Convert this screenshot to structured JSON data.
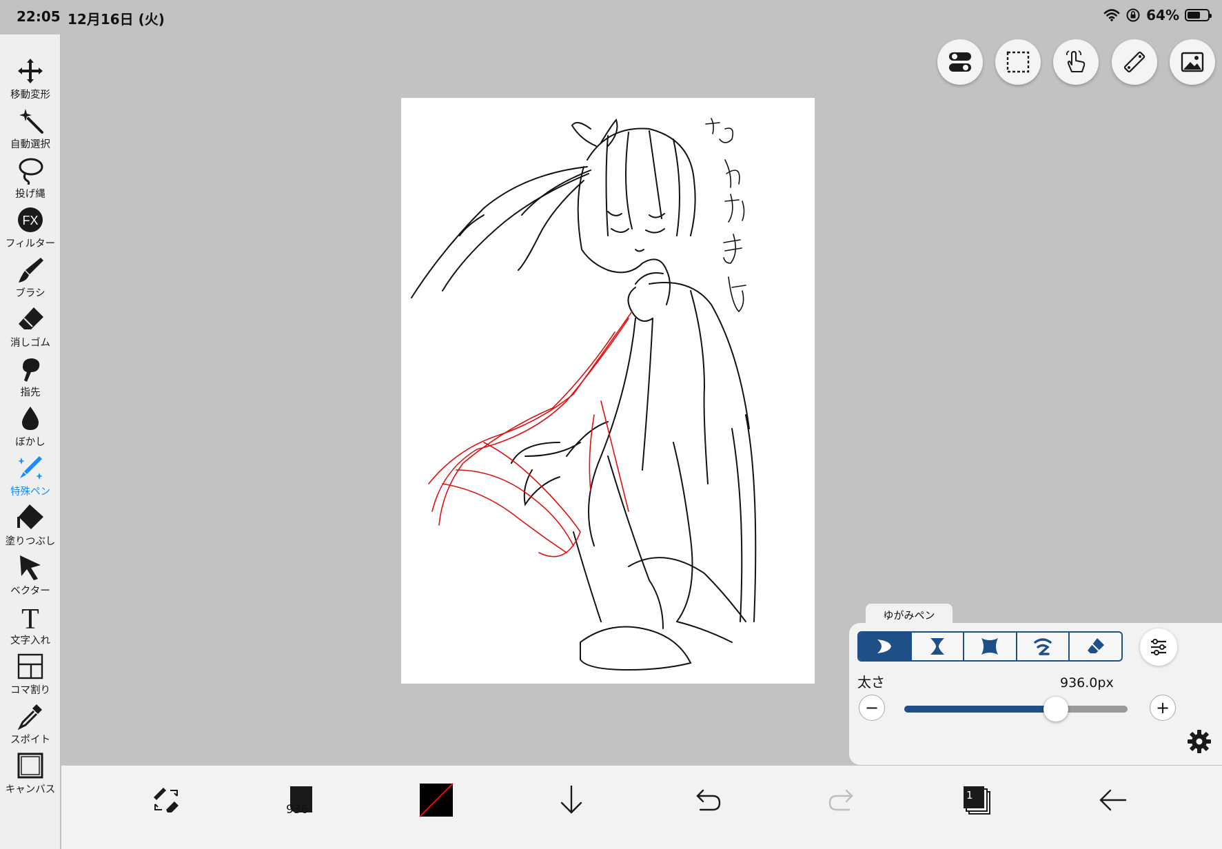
{
  "status": {
    "time": "22:05",
    "date": "12月16日 (火)",
    "battery": "64%",
    "battery_level": 0.64
  },
  "tools": [
    {
      "label": "移動変形",
      "icon": "move-arrows-icon"
    },
    {
      "label": "自動選択",
      "icon": "magic-wand-icon"
    },
    {
      "label": "投げ縄",
      "icon": "lasso-icon"
    },
    {
      "label": "フィルター",
      "icon": "fx-filter-icon"
    },
    {
      "label": "ブラシ",
      "icon": "brush-icon"
    },
    {
      "label": "消しゴム",
      "icon": "eraser-icon"
    },
    {
      "label": "指先",
      "icon": "finger-smudge-icon"
    },
    {
      "label": "ぼかし",
      "icon": "blur-drop-icon"
    },
    {
      "label": "特殊ペン",
      "icon": "special-pen-icon",
      "active": true
    },
    {
      "label": "塗りつぶし",
      "icon": "bucket-fill-icon"
    },
    {
      "label": "ベクター",
      "icon": "vector-cursor-icon"
    },
    {
      "label": "文字入れ",
      "icon": "text-icon"
    },
    {
      "label": "コマ割り",
      "icon": "panel-layout-icon"
    },
    {
      "label": "スポイト",
      "icon": "eyedropper-icon"
    },
    {
      "label": "キャンバス",
      "icon": "canvas-icon"
    }
  ],
  "top_buttons": [
    {
      "icon": "toggle-switches-icon"
    },
    {
      "icon": "selection-rect-icon"
    },
    {
      "icon": "hand-gesture-icon"
    },
    {
      "icon": "ruler-icon"
    },
    {
      "icon": "image-icon"
    }
  ],
  "pen_panel": {
    "tab_label": "ゆがみペン",
    "modes": [
      {
        "icon": "crescent-icon",
        "active": true
      },
      {
        "icon": "pinch-hourglass-icon"
      },
      {
        "icon": "bloat-icon"
      },
      {
        "icon": "swirl-icon"
      },
      {
        "icon": "eraser-icon"
      }
    ],
    "size_label": "太さ",
    "size_value": "936.0px",
    "size_fraction": 0.68,
    "minus": "−",
    "plus": "+"
  },
  "bottom_bar": {
    "brush_size": "936",
    "layer_count": "1"
  }
}
